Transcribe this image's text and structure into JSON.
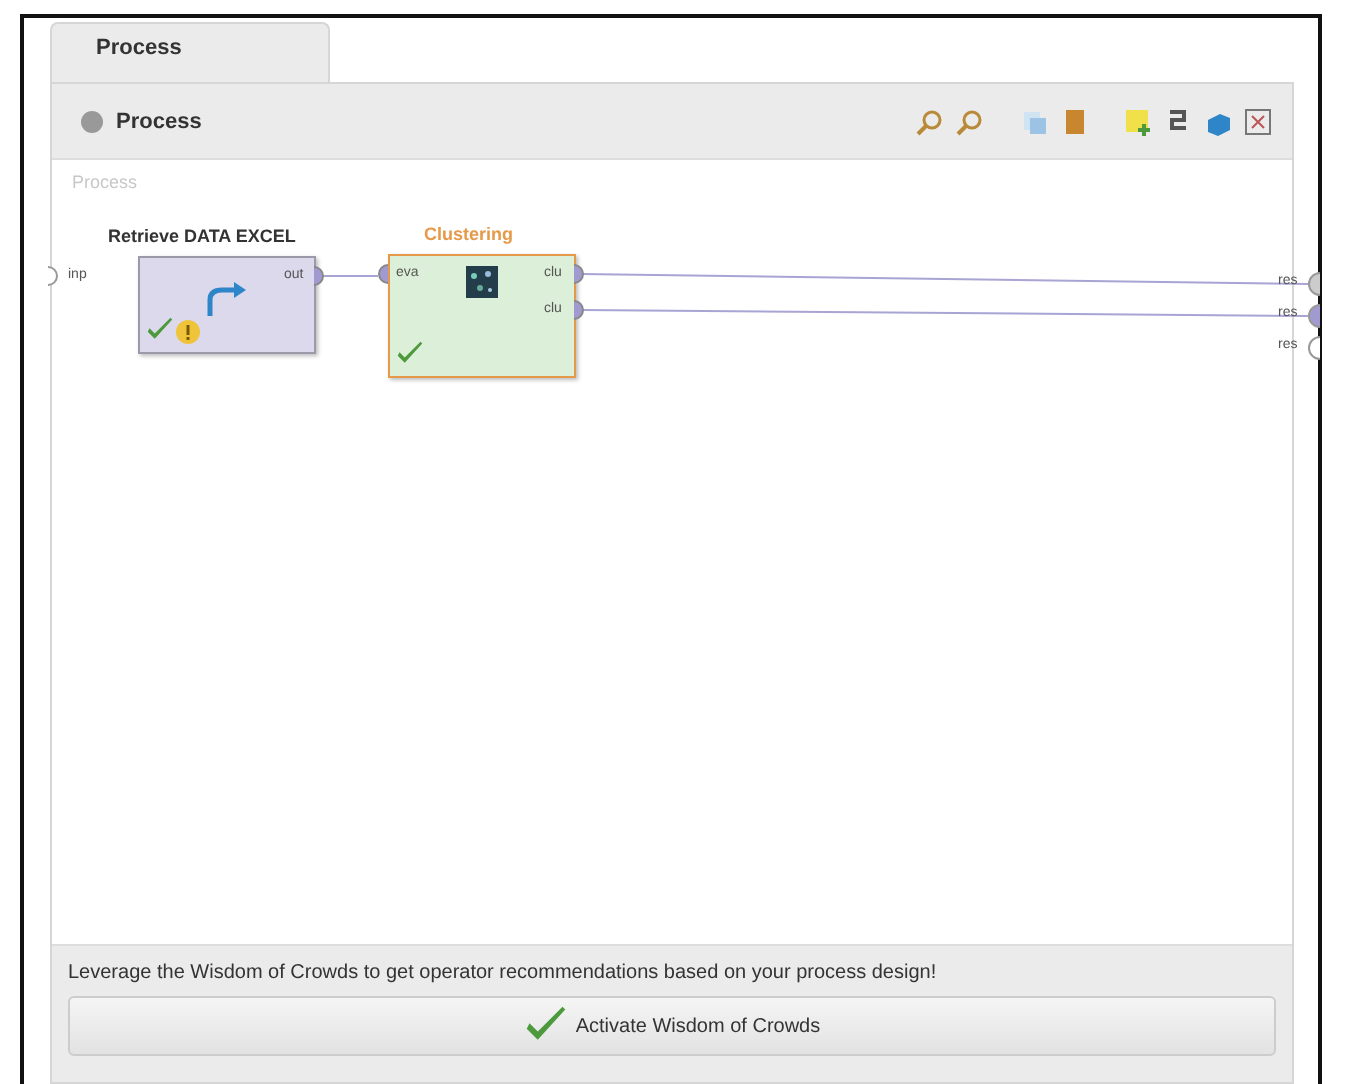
{
  "tabs": [
    {
      "label": "Process",
      "selected": true
    }
  ],
  "toolbar": {
    "title": "Process"
  },
  "canvas": {
    "label": "Process",
    "input_ports": [
      {
        "label": "inp",
        "connected": false
      }
    ],
    "operators": [
      {
        "name": "Retrieve DATA EXCEL",
        "kind": "retrieve",
        "ok": true,
        "warning": true,
        "ports_out": [
          {
            "label": "out",
            "connected": true
          }
        ]
      },
      {
        "name": "Clustering",
        "kind": "clustering",
        "ok": true,
        "warning": false,
        "ports_in": [
          {
            "label": "eva",
            "connected": true
          }
        ],
        "ports_out": [
          {
            "label": "clu",
            "connected": true
          },
          {
            "label": "clu",
            "connected": true
          }
        ]
      }
    ],
    "result_ports": [
      {
        "label": "res",
        "connected": true
      },
      {
        "label": "res",
        "connected": true
      },
      {
        "label": "res",
        "connected": false
      }
    ]
  },
  "recommendation": {
    "text": "Leverage the Wisdom of Crowds to get operator recommendations based on your process design!",
    "button": "Activate Wisdom of Crowds"
  }
}
